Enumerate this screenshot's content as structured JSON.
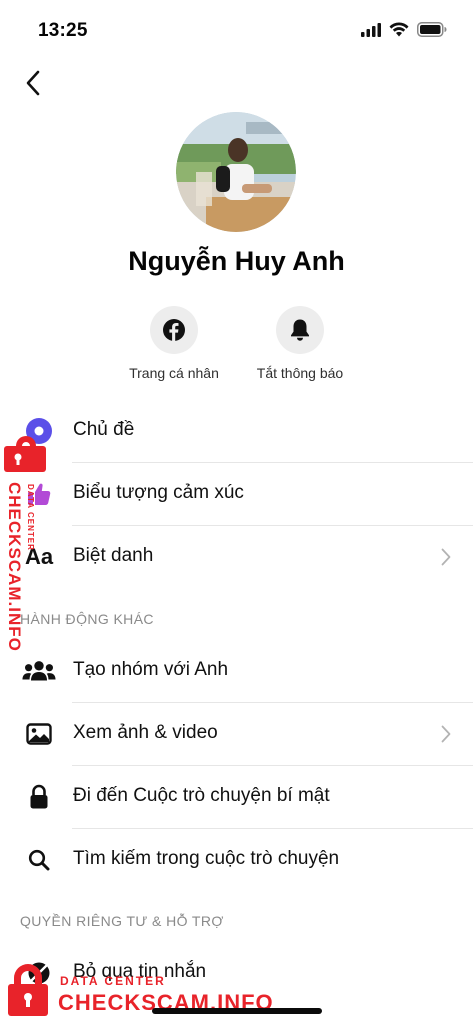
{
  "status_bar": {
    "time": "13:25",
    "icons": [
      "cellular-signal-icon",
      "wifi-icon",
      "battery-icon"
    ]
  },
  "header": {
    "back_icon": "chevron-left-icon"
  },
  "profile": {
    "name": "Nguyễn Huy Anh",
    "avatar_icon": "profile-photo"
  },
  "actions": [
    {
      "label": "Trang cá nhân",
      "icon": "facebook-icon"
    },
    {
      "label": "Tắt thông báo",
      "icon": "bell-icon"
    }
  ],
  "customize": [
    {
      "label": "Chủ đề",
      "icon": "theme-icon",
      "chevron": false
    },
    {
      "label": "Biểu tượng cảm xúc",
      "icon": "thumbs-up-icon",
      "chevron": false
    },
    {
      "label": "Biệt danh",
      "icon": "text-aa-icon",
      "icon_text": "Aa",
      "chevron": true
    }
  ],
  "more_actions": {
    "header": "HÀNH ĐỘNG KHÁC",
    "items": [
      {
        "label": "Tạo nhóm với Anh",
        "icon": "group-icon",
        "chevron": false
      },
      {
        "label": "Xem ảnh & video",
        "icon": "image-icon",
        "chevron": true
      },
      {
        "label": "Đi đến Cuộc trò chuyện bí mật",
        "icon": "lock-icon",
        "chevron": false
      },
      {
        "label": "Tìm kiếm trong cuộc trò chuyện",
        "icon": "search-icon",
        "chevron": false
      }
    ]
  },
  "privacy": {
    "header": "QUYỀN RIÊNG TƯ & HỖ TRỢ",
    "items": [
      {
        "label": "Bỏ qua tin nhắn",
        "icon": "ignore-icon",
        "chevron": false
      }
    ]
  },
  "watermark": {
    "text": "CHECKSCAM.INFO",
    "subtext": "DATA CENTER"
  },
  "colors": {
    "theme_accent": "#5b4fe8",
    "thumbs_accent": "#b24ad6",
    "watermark_red": "#e8232a",
    "secondary_text": "#8a8a8a"
  }
}
